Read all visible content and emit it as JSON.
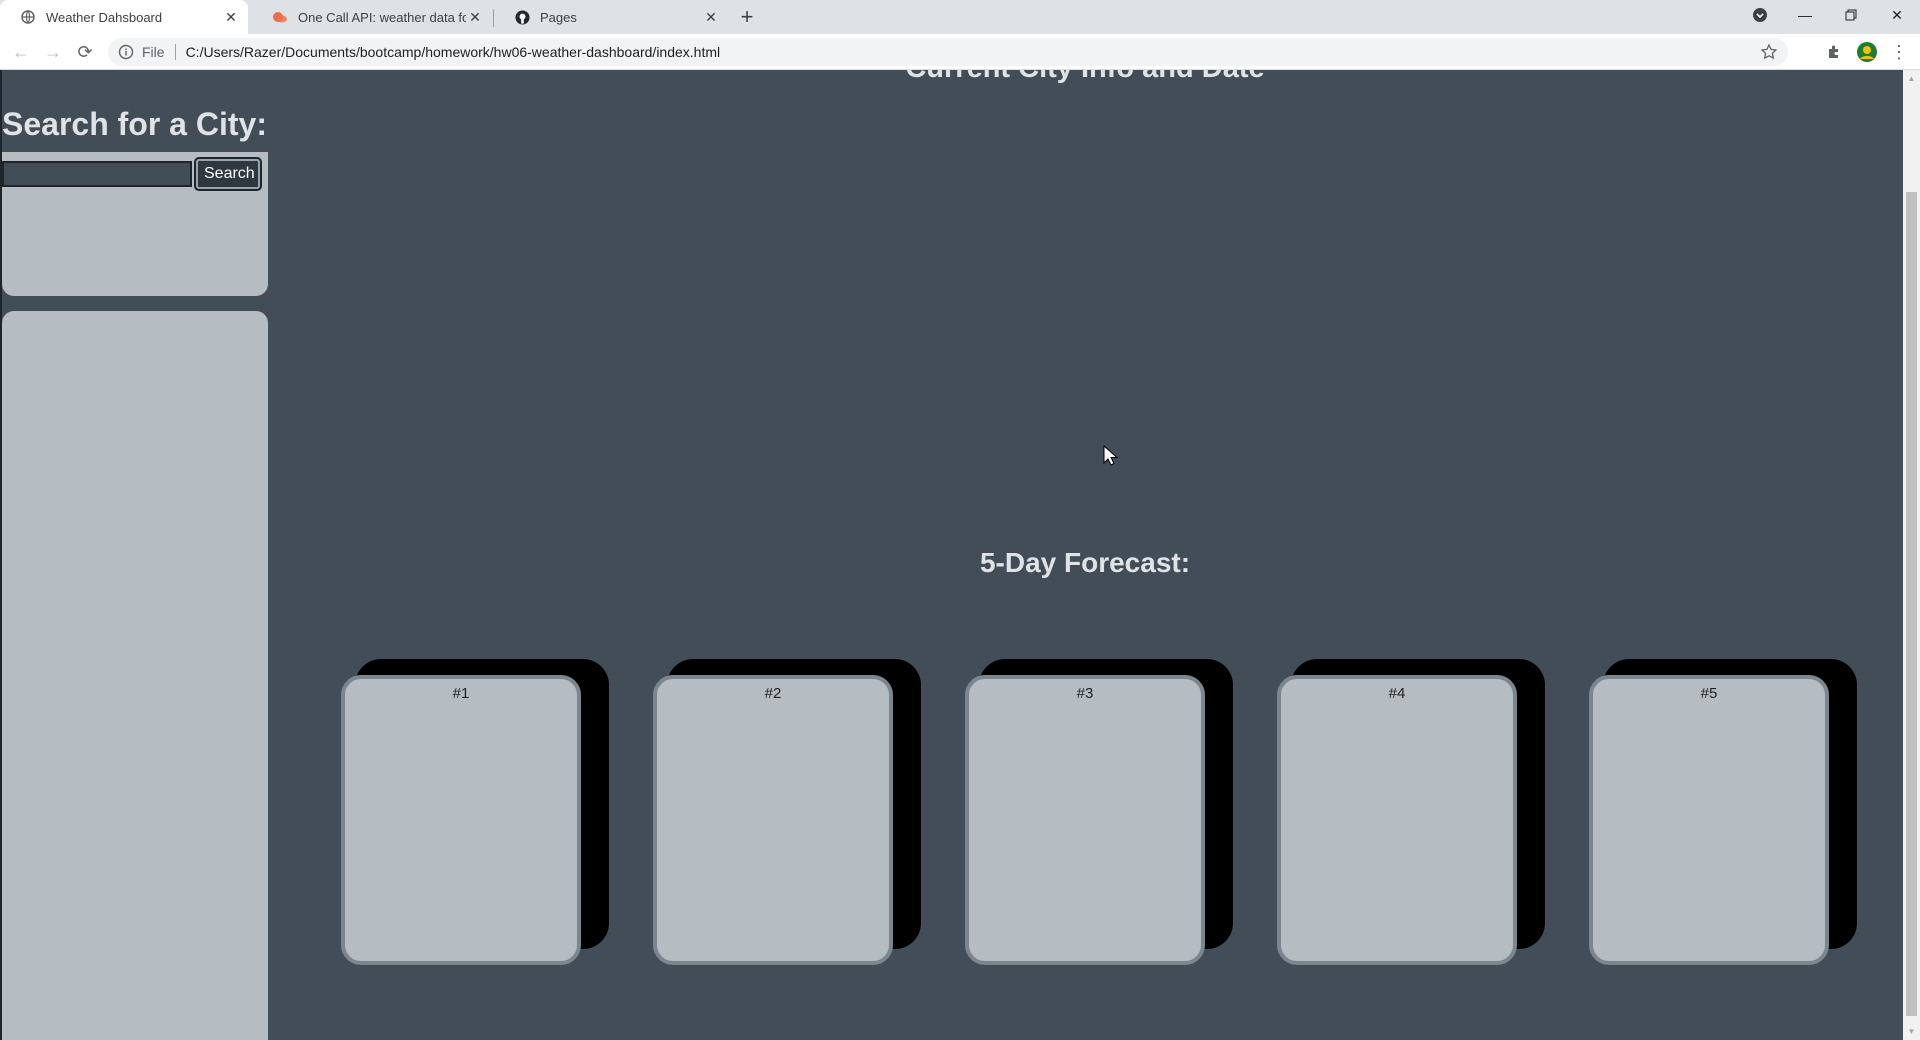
{
  "browser": {
    "tabs": [
      {
        "title": "Weather Dahsboard",
        "active": true
      },
      {
        "title": "One Call API: weather data for an",
        "active": false
      },
      {
        "title": "Pages",
        "active": false
      }
    ],
    "address": {
      "scheme": "File",
      "url": "C:/Users/Razer/Documents/bootcamp/homework/hw06-weather-dashboard/index.html"
    }
  },
  "page": {
    "current_title": "Current City Info and Date",
    "search_heading": "Search for a City:",
    "search_input_value": "",
    "search_button": "Search",
    "forecast_title": "5-Day Forecast:",
    "cards": [
      {
        "label": "#1"
      },
      {
        "label": "#2"
      },
      {
        "label": "#3"
      },
      {
        "label": "#4"
      },
      {
        "label": "#5"
      }
    ]
  },
  "colors": {
    "page_bg": "#434d57",
    "panel_bg": "#b5bcc2",
    "heading_text": "#dfe3e6"
  }
}
